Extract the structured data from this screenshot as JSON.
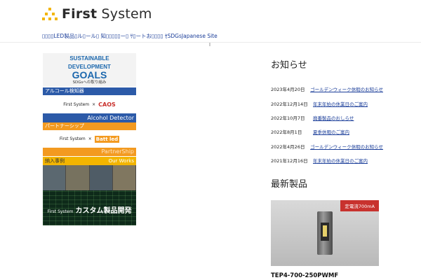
{
  "header": {
    "logo_bold": "First",
    "logo_light": "System",
    "nav_text": "▯▯▯▯LED製品▯ル▯ール▯ 知▯▯▯▯▯ー▯ ｻ▯ートお▯▯▯▯ ｾSDGsJapanese Site"
  },
  "banners": {
    "sdg": {
      "line1": "SUSTAINABLE",
      "line2": "DEVELOPMENT",
      "line3": "GOALS",
      "line4": "SDGsへの取り組み"
    },
    "alcohol": {
      "header": "アルコール検知器",
      "partner_a": "First System",
      "cross": "×",
      "partner_b": "CAOS",
      "footer": "Alcohol Detector"
    },
    "partner": {
      "header": "パートナーシップ",
      "partner_a": "First System",
      "cross": "×",
      "partner_b": "Batt led",
      "footer": "PartnerShip"
    },
    "works": {
      "header": "納入事例",
      "header_en": "Our Works"
    },
    "custom": {
      "brand": "First System",
      "label": "カスタム製品開発"
    }
  },
  "news": {
    "heading": "お知らせ",
    "items": [
      {
        "date": "2023年4月20日",
        "title": "ゴールデンウィーク休暇のお知らせ"
      },
      {
        "date": "2022年12月14日",
        "title": "年末年始の休業日のご案内"
      },
      {
        "date": "2022年10月7日",
        "title": "廃番製品のおしらせ"
      },
      {
        "date": "2022年8月1日",
        "title": "夏季休暇のご案内"
      },
      {
        "date": "2022年4月26日",
        "title": "ゴールデンウィーク休暇のお知らせ"
      },
      {
        "date": "2021年12月16日",
        "title": "年末年始の休業日のご案内"
      }
    ]
  },
  "products": {
    "heading": "最新製品",
    "badge": "定電流700mA",
    "name": "TEP4-700-250PWMF"
  },
  "colors": {
    "brand_yellow": "#f3b500",
    "link_blue": "#1a3d99",
    "sdg_blue": "#1b67ad",
    "alcohol_blue": "#2c5aa8",
    "partner_orange": "#f39a20",
    "badge_red": "#c8322e"
  }
}
